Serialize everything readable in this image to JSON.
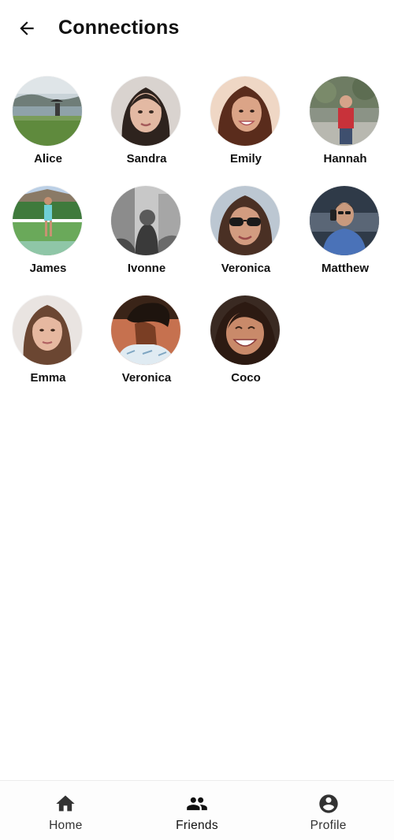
{
  "header": {
    "back_icon": "arrow-left-icon",
    "title": "Connections"
  },
  "connections": [
    {
      "name": "Alice",
      "avatar": "photo-lake-umbrella"
    },
    {
      "name": "Sandra",
      "avatar": "photo-portrait-dark-hair"
    },
    {
      "name": "Emily",
      "avatar": "photo-portrait-smile"
    },
    {
      "name": "Hannah",
      "avatar": "photo-outdoor-red-top"
    },
    {
      "name": "James",
      "avatar": "photo-tennis-court"
    },
    {
      "name": "Ivonne",
      "avatar": "photo-black-white"
    },
    {
      "name": "Veronica",
      "avatar": "photo-sunglasses"
    },
    {
      "name": "Matthew",
      "avatar": "photo-man-phone"
    },
    {
      "name": "Emma",
      "avatar": "photo-portrait-light"
    },
    {
      "name": "Veronica",
      "avatar": "photo-profile-side"
    },
    {
      "name": "Coco",
      "avatar": "photo-selfie-laugh"
    }
  ],
  "bottom_nav": {
    "items": [
      {
        "label": "Home",
        "icon": "home-icon",
        "active": false
      },
      {
        "label": "Friends",
        "icon": "people-icon",
        "active": true
      },
      {
        "label": "Profile",
        "icon": "account-circle-icon",
        "active": false
      }
    ]
  }
}
